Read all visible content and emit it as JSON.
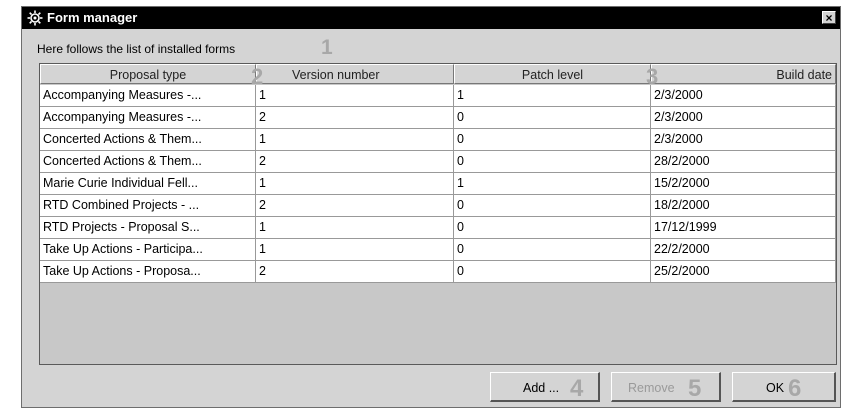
{
  "window": {
    "title": "Form manager",
    "close_glyph": "×",
    "title_icon": "gear-icon"
  },
  "intro_text": "Here follows the list of installed forms",
  "markers": [
    "1",
    "2",
    "3",
    "4",
    "5",
    "6"
  ],
  "table": {
    "columns": [
      "Proposal type",
      "Version number",
      "Patch level",
      "Build date"
    ],
    "rows": [
      [
        "Accompanying Measures -...",
        "1",
        "1",
        "2/3/2000"
      ],
      [
        "Accompanying Measures -...",
        "2",
        "0",
        "2/3/2000"
      ],
      [
        "Concerted Actions & Them...",
        "1",
        "0",
        "2/3/2000"
      ],
      [
        "Concerted Actions & Them...",
        "2",
        "0",
        "28/2/2000"
      ],
      [
        "Marie Curie Individual Fell...",
        "1",
        "1",
        "15/2/2000"
      ],
      [
        "RTD Combined Projects - ...",
        "2",
        "0",
        "18/2/2000"
      ],
      [
        "RTD Projects - Proposal S...",
        "1",
        "0",
        "17/12/1999"
      ],
      [
        "Take Up Actions - Participa...",
        "1",
        "0",
        "22/2/2000"
      ],
      [
        "Take Up Actions - Proposa...",
        "2",
        "0",
        "25/2/2000"
      ]
    ]
  },
  "buttons": {
    "add": "Add ...",
    "remove": "Remove",
    "ok": "OK"
  }
}
